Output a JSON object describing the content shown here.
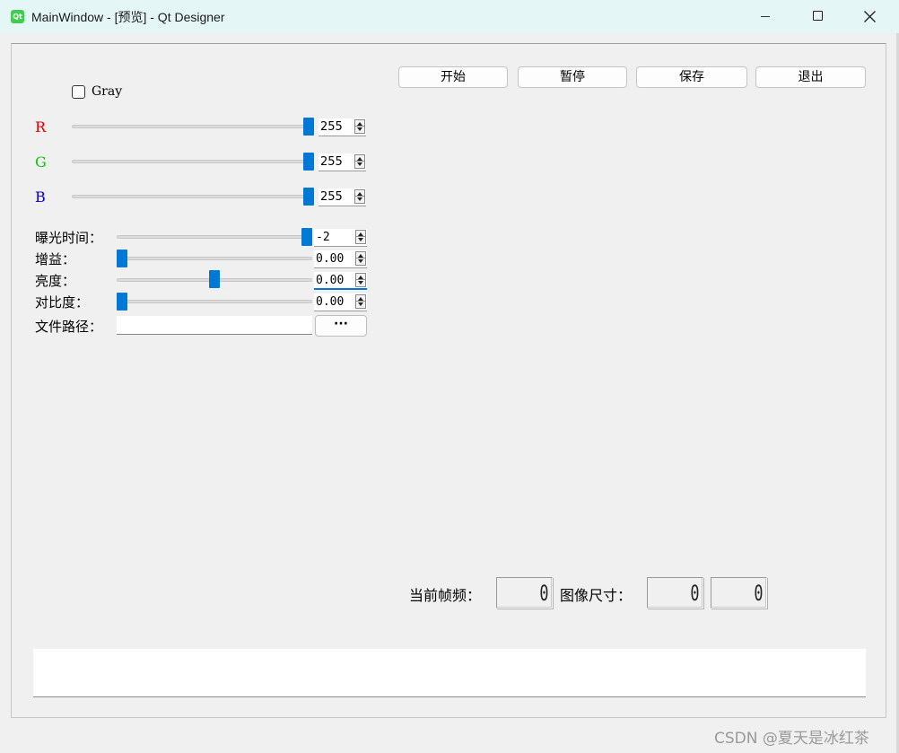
{
  "window": {
    "title": "MainWindow - [预览] - Qt Designer",
    "icon_text": "Qt"
  },
  "toolbar": {
    "start_label": "开始",
    "pause_label": "暂停",
    "save_label": "保存",
    "exit_label": "退出"
  },
  "gray": {
    "label": "Gray",
    "checked": false
  },
  "rgb": [
    {
      "label": "R",
      "color": "#e00000",
      "value": "255",
      "slider_fraction": 1.0
    },
    {
      "label": "G",
      "color": "#00cc00",
      "value": "255",
      "slider_fraction": 1.0
    },
    {
      "label": "B",
      "color": "#0000cc",
      "value": "255",
      "slider_fraction": 1.0
    }
  ],
  "camera": {
    "exposure": {
      "label": "曝光时间：",
      "value": "-2",
      "slider_fraction": 1.0
    },
    "gain": {
      "label": "增益：",
      "value": "0.00",
      "slider_fraction": 0.0
    },
    "brightness": {
      "label": "亮度：",
      "value": "0.00",
      "slider_fraction": 0.5
    },
    "contrast": {
      "label": "对比度：",
      "value": "0.00",
      "slider_fraction": 0.0
    }
  },
  "file": {
    "label": "文件路径：",
    "path_value": "",
    "browse_label": "···"
  },
  "stats": {
    "fps_label": "当前帧频：",
    "fps_value": "0",
    "size_label": "图像尺寸：",
    "width_value": "0",
    "height_value": "0"
  },
  "status_text": "",
  "watermark": "CSDN @夏天是冰红茶",
  "accent_color": "#0078d4"
}
